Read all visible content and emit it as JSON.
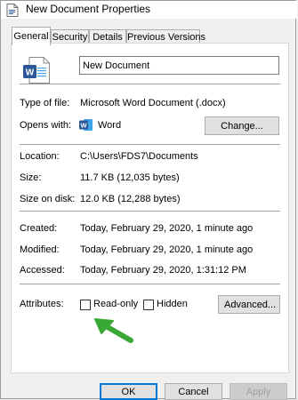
{
  "window": {
    "title": "New Document Properties"
  },
  "tabs": [
    {
      "label": "General",
      "active": true
    },
    {
      "label": "Security",
      "active": false
    },
    {
      "label": "Details",
      "active": false
    },
    {
      "label": "Previous Versions",
      "active": false
    }
  ],
  "general": {
    "file_name": "New Document",
    "type_label": "Type of file:",
    "type_value": "Microsoft Word Document (.docx)",
    "opens_label": "Opens with:",
    "opens_value": "Word",
    "change_button": "Change...",
    "location_label": "Location:",
    "location_value": "C:\\Users\\FDS7\\Documents",
    "size_label": "Size:",
    "size_value": "11.7 KB (12,035 bytes)",
    "size_on_disk_label": "Size on disk:",
    "size_on_disk_value": "12.0 KB (12,288 bytes)",
    "created_label": "Created:",
    "created_value": "Today, February 29, 2020, 1 minute ago",
    "modified_label": "Modified:",
    "modified_value": "Today, February 29, 2020, 1 minute ago",
    "accessed_label": "Accessed:",
    "accessed_value": "Today, February 29, 2020, 1:31:12 PM",
    "attributes_label": "Attributes:",
    "readonly_label": "Read-only",
    "hidden_label": "Hidden",
    "advanced_button": "Advanced..."
  },
  "footer": {
    "ok": "OK",
    "cancel": "Cancel",
    "apply": "Apply"
  },
  "colors": {
    "word_blue": "#2b579a",
    "arrow_green": "#3aa835"
  },
  "icons": {
    "title": "document-icon",
    "file": "word-document-icon",
    "opens_with": "word-app-icon",
    "annotation": "green-arrow-icon"
  }
}
